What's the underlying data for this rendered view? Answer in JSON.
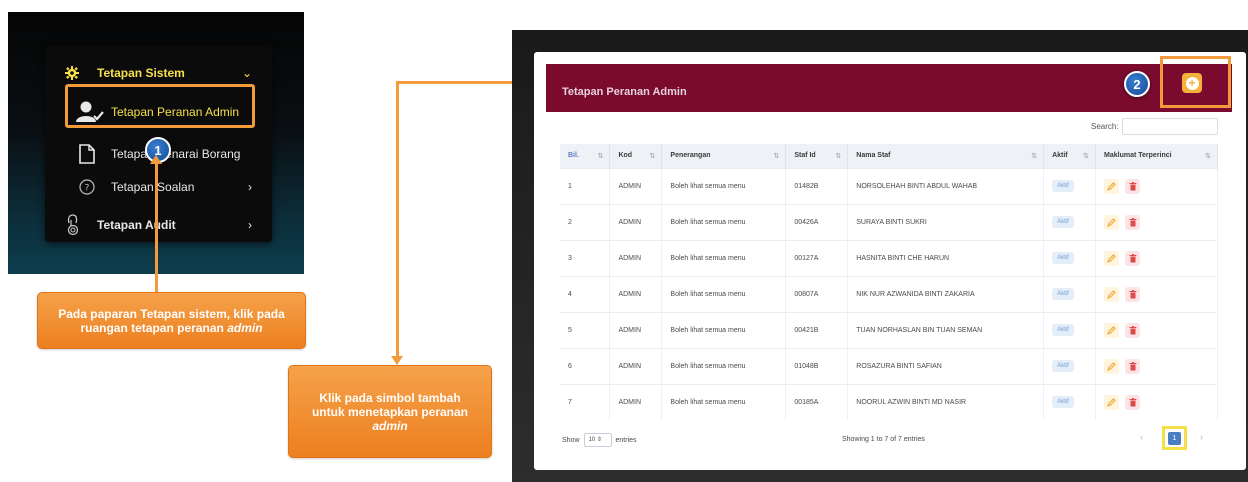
{
  "sidebar": {
    "section_title": "Tetapan Sistem",
    "items": [
      {
        "label": "Tetapan Peranan Admin"
      },
      {
        "label": "Tetapan Senarai Borang"
      },
      {
        "label": "Tetapan Soalan"
      }
    ],
    "audit_label": "Tetapan Audit"
  },
  "callouts": {
    "step1_text": "Pada paparan Tetapan sistem, klik pada ruangan tetapan peranan",
    "step1_em": "admin",
    "step2_text": "Klik pada simbol tambah untuk menetapkan peranan",
    "step2_em": "admin"
  },
  "badges": {
    "step1": "1",
    "step2": "2"
  },
  "card": {
    "title": "Tetapan Peranan Admin"
  },
  "search": {
    "label": "Search:",
    "placeholder": ""
  },
  "table": {
    "columns": [
      "Bil.",
      "Kod",
      "Penerangan",
      "Staf Id",
      "Nama Staf",
      "Aktif",
      "Maklumat Terperinci"
    ],
    "rows": [
      {
        "bil": "1",
        "kod": "ADMIN",
        "penerangan": "Boleh lihat semua menu",
        "staf_id": "01482B",
        "nama": "NORSOLEHAH BINTI ABDUL WAHAB",
        "aktif": "Aktif"
      },
      {
        "bil": "2",
        "kod": "ADMIN",
        "penerangan": "Boleh lihat semua menu",
        "staf_id": "00426A",
        "nama": "SURAYA BINTI SUKRI",
        "aktif": "Aktif"
      },
      {
        "bil": "3",
        "kod": "ADMIN",
        "penerangan": "Boleh lihat semua menu",
        "staf_id": "00127A",
        "nama": "HASNITA BINTI CHE HARUN",
        "aktif": "Aktif"
      },
      {
        "bil": "4",
        "kod": "ADMIN",
        "penerangan": "Boleh lihat semua menu",
        "staf_id": "00807A",
        "nama": "NIK NUR AZWANIDA BINTI ZAKARIA",
        "aktif": "Aktif"
      },
      {
        "bil": "5",
        "kod": "ADMIN",
        "penerangan": "Boleh lihat semua menu",
        "staf_id": "00421B",
        "nama": "TUAN NORHASLAN BIN TUAN SEMAN",
        "aktif": "Aktif"
      },
      {
        "bil": "6",
        "kod": "ADMIN",
        "penerangan": "Boleh lihat semua menu",
        "staf_id": "01048B",
        "nama": "ROSAZURA BINTI SAFIAN",
        "aktif": "Aktif"
      },
      {
        "bil": "7",
        "kod": "ADMIN",
        "penerangan": "Boleh lihat semua menu",
        "staf_id": "00185A",
        "nama": "NOORUL AZWIN BINTI MD NASIR",
        "aktif": "Aktif"
      }
    ]
  },
  "footer": {
    "show_label": "Show",
    "page_size": "10",
    "entries_label": "entries",
    "info": "Showing 1 to 7 of 7 entries",
    "current_page": "1"
  },
  "colors": {
    "accent_orange": "#f29a3c",
    "header_maroon": "#7a0a2e",
    "menu_yellow": "#f5e04a",
    "badge_blue": "#1d5ba8"
  },
  "icons": {
    "section": "gear-icon",
    "peranan": "user-check-icon",
    "senarai": "document-icon",
    "soalan": "question-circle-icon",
    "audit": "fingerprint-icon",
    "add": "plus-circle-icon",
    "edit": "pencil-icon",
    "delete": "trash-icon"
  }
}
